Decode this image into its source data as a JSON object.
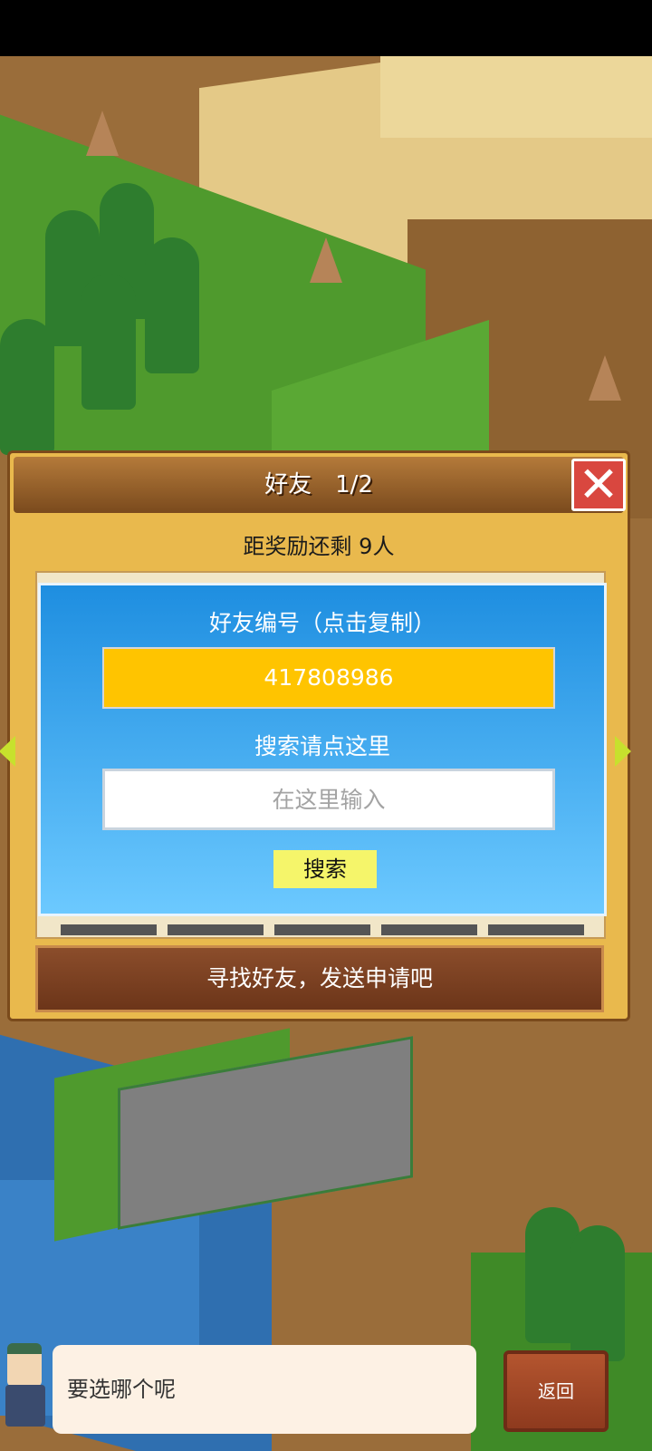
{
  "dialog": {
    "title": "好友　1/2",
    "reward_text": "距奖励还剩 9人",
    "friend_code_label": "好友编号（点击复制）",
    "friend_code": "417808986",
    "search_label": "搜索请点这里",
    "search_placeholder": "在这里输入",
    "search_button": "搜索",
    "find_friends_text": "寻找好友，发送申请吧",
    "close_icon": "close-icon",
    "arrow_left_icon": "triangle-left-icon",
    "arrow_right_icon": "triangle-right-icon"
  },
  "bottom": {
    "bubble_text": "要选哪个呢",
    "back_button": "返回"
  },
  "colors": {
    "panel_blue": "#1e8ee0",
    "code_yellow": "#ffc400",
    "search_button_bg": "#f5f56a",
    "close_red": "#d9473f",
    "dialog_gold": "#e9b94d"
  }
}
